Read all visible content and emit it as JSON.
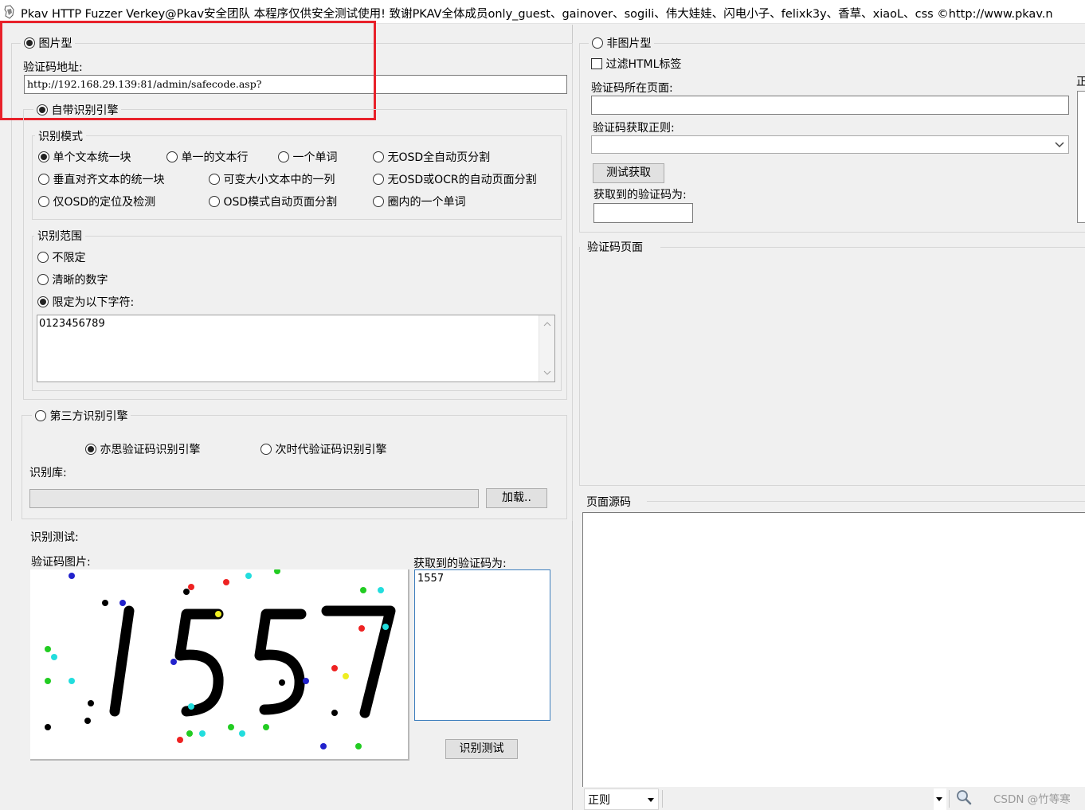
{
  "window": {
    "title": "Pkav HTTP Fuzzer   Verkey@Pkav安全团队  本程序仅供安全测试使用!  致谢PKAV全体成员only_guest、gainover、sogili、伟大娃娃、闪电小子、felixk3y、香草、xiaoL、css  ©http://www.pkav.n"
  },
  "left": {
    "image_type_label": "图片型",
    "captcha_url_label": "验证码地址:",
    "captcha_url_value": "http://192.168.29.139:81/admin/safecode.asp?",
    "builtin_engine_label": "自带识别引擎",
    "mode_legend": "识别模式",
    "modes": [
      "单个文本统一块",
      "单一的文本行",
      "一个单词",
      "无OSD全自动页分割",
      "垂直对齐文本的统一块",
      "可变大小文本中的一列",
      "无OSD或OCR的自动页面分割",
      "仅OSD的定位及检测",
      "OSD模式自动页面分割",
      "圈内的一个单词"
    ],
    "range_legend": "识别范围",
    "range_options": [
      "不限定",
      "清晰的数字",
      "限定为以下字符:"
    ],
    "range_chars": "0123456789",
    "third_party_label": "第三方识别引擎",
    "third_engines": [
      "亦思验证码识别引擎",
      "次时代验证码识别引擎"
    ],
    "library_label": "识别库:",
    "load_button": "加载..",
    "test_legend": "识别测试:",
    "captcha_image_label": "验证码图片:",
    "captcha_text": "1557",
    "result_label": "获取到的验证码为:",
    "result_value": "1557",
    "test_button": "识别测试"
  },
  "right": {
    "non_image_label": "非图片型",
    "filter_html_label": "过滤HTML标签",
    "page_label": "验证码所在页面:",
    "regex_label": "验证码获取正则:",
    "fetch_button": "测试获取",
    "fetched_label": "获取到的验证码为:",
    "edge_char": "正",
    "captcha_page_legend": "验证码页面",
    "source_legend": "页面源码",
    "regex_bottom": "正则",
    "watermark": "CSDN @竹等寒"
  }
}
